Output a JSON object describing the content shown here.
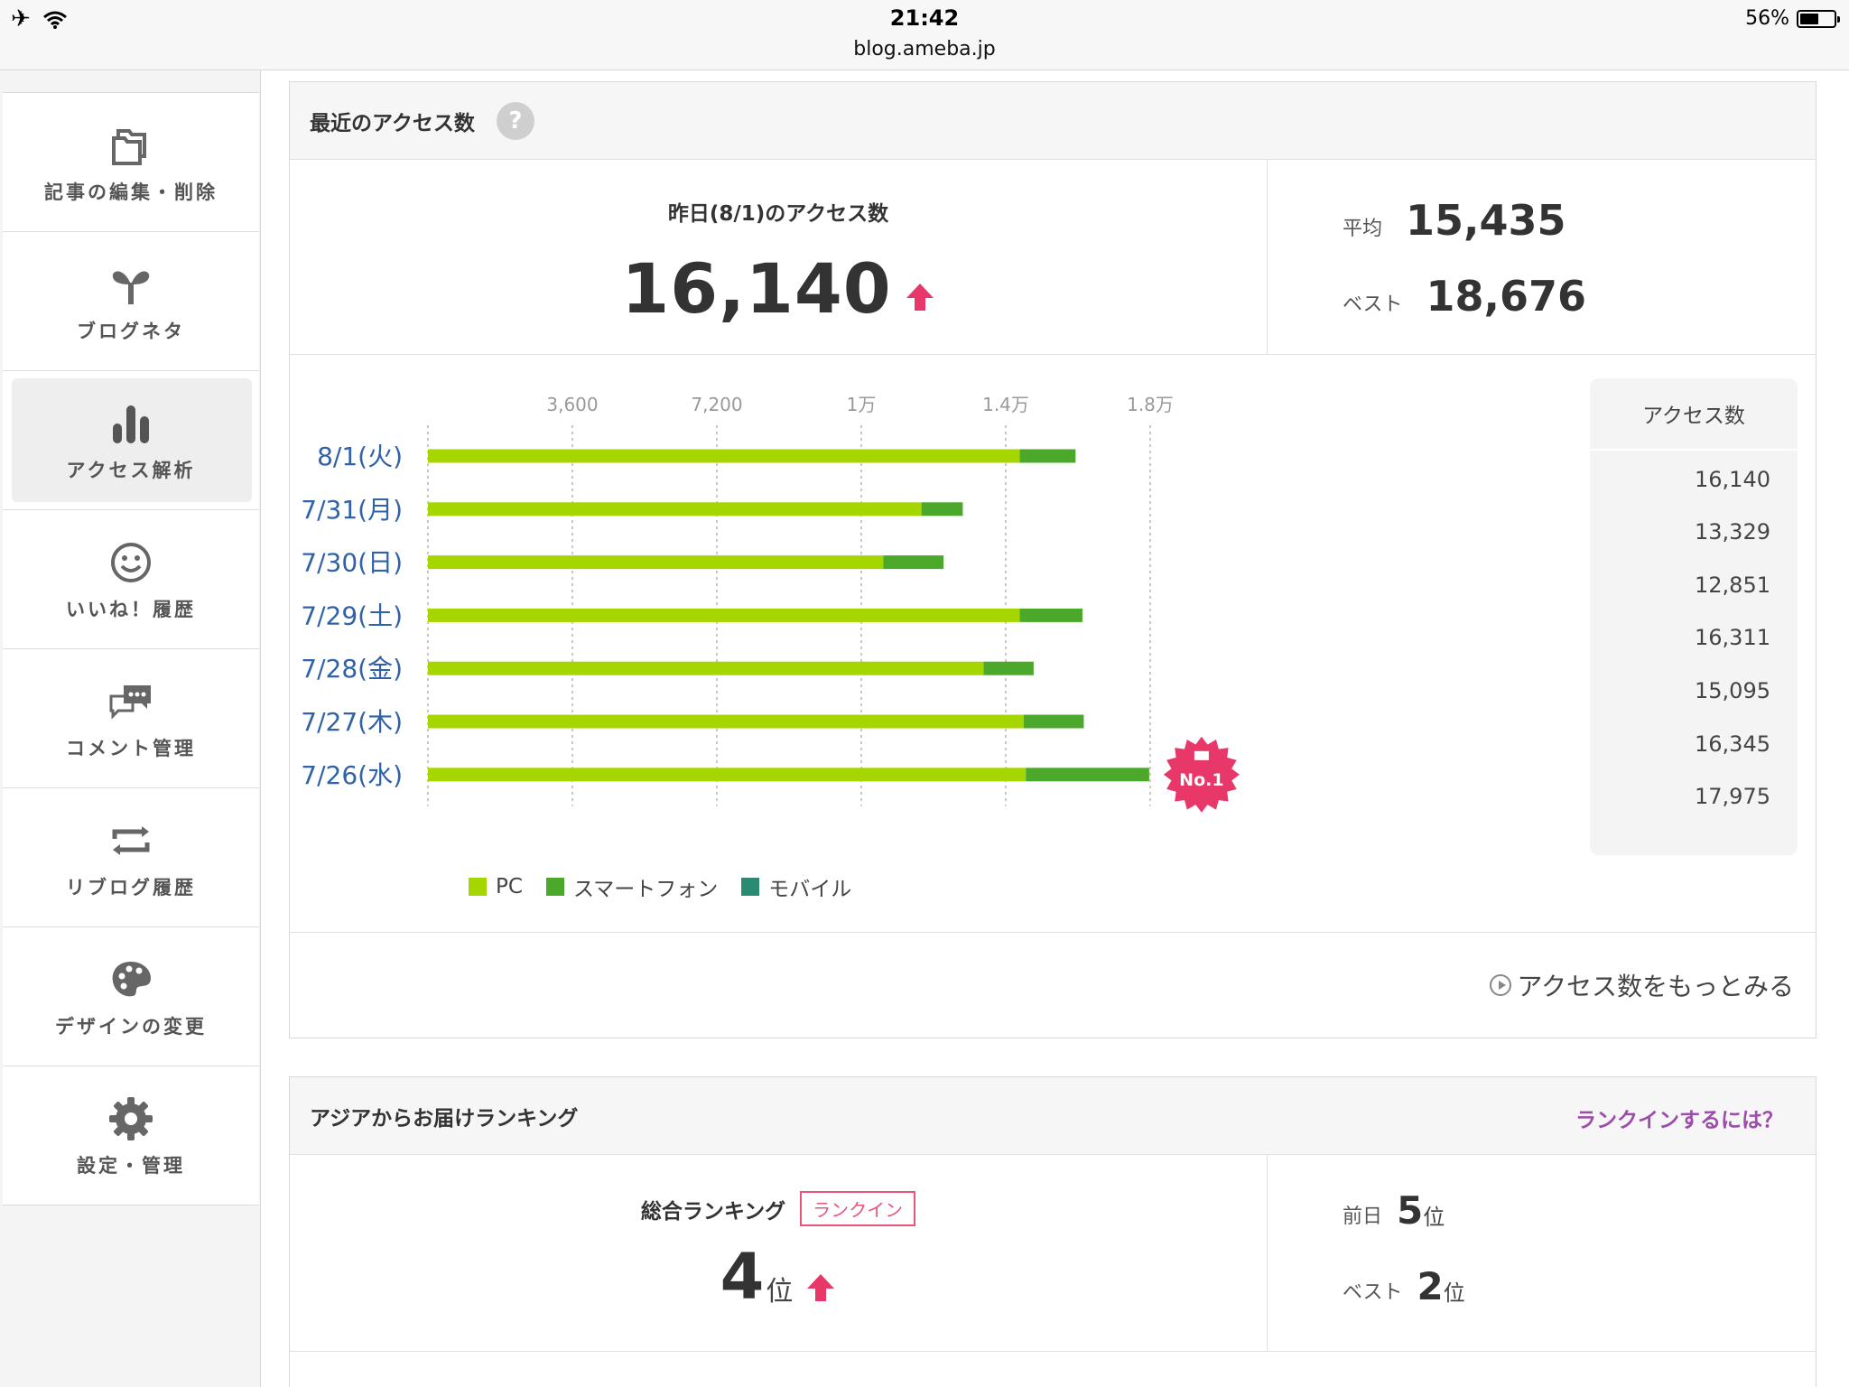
{
  "status_bar": {
    "time": "21:42",
    "url": "blog.ameba.jp",
    "battery": "56%",
    "battery_level": 0.56
  },
  "sidebar": {
    "items": [
      {
        "label": "記事の編集・削除",
        "icon": "folder-icon"
      },
      {
        "label": "ブログネタ",
        "icon": "sprout-icon"
      },
      {
        "label": "アクセス解析",
        "icon": "bar-chart-icon",
        "active": true
      },
      {
        "label": "いいね！履歴",
        "icon": "smile-icon"
      },
      {
        "label": "コメント管理",
        "icon": "speech-bubbles-icon"
      },
      {
        "label": "リブログ履歴",
        "icon": "reblog-icon"
      },
      {
        "label": "デザインの変更",
        "icon": "palette-icon"
      },
      {
        "label": "設定・管理",
        "icon": "gear-icon"
      }
    ]
  },
  "access": {
    "title": "最近のアクセス数",
    "help": "?",
    "yesterday_label": "昨日(8/1)のアクセス数",
    "yesterday_value": "16,140",
    "avg_label": "平均",
    "avg_value": "15,435",
    "best_label": "ベスト",
    "best_value": "18,676",
    "side_header": "アクセス数",
    "more_link": "アクセス数をもっとみる",
    "badge": "No.1"
  },
  "chart_data": {
    "type": "bar",
    "orientation": "horizontal",
    "stacked": true,
    "categories": [
      "8/1(火)",
      "7/31(月)",
      "7/30(日)",
      "7/29(土)",
      "7/28(金)",
      "7/27(木)",
      "7/26(水)"
    ],
    "series": [
      {
        "name": "PC",
        "color": "#a5d600",
        "values": [
          14750,
          12300,
          11350,
          14750,
          13850,
          14850,
          14900
        ]
      },
      {
        "name": "スマートフォン",
        "color": "#4ca82a",
        "values": [
          1390,
          1029,
          1501,
          1561,
          1245,
          1495,
          3075
        ]
      },
      {
        "name": "モバイル",
        "color": "#2a8a72",
        "values": [
          0,
          0,
          0,
          0,
          0,
          0,
          0
        ]
      }
    ],
    "totals": [
      "16,140",
      "13,329",
      "12,851",
      "16,311",
      "15,095",
      "16,345",
      "17,975"
    ],
    "x_ticks": [
      "3,600",
      "7,200",
      "1万",
      "1.4万",
      "1.8万"
    ],
    "x_tick_values": [
      3600,
      7200,
      10800,
      14400,
      18000
    ],
    "xlim": [
      0,
      18000
    ],
    "grid": true,
    "legend_position": "bottom-left"
  },
  "ranking": {
    "title": "アジアからお届けランキング",
    "link": "ランクインするには？",
    "overall_label": "総合ランキング",
    "rankin_badge": "ランクイン",
    "current": "4",
    "unit": "位",
    "prev_label": "前日",
    "prev_value": "5",
    "best_label": "ベスト",
    "best_value": "2"
  },
  "colors": {
    "accent_pink": "#e8386a",
    "link_purple": "#9b4ea8",
    "date_blue": "#2f62a8"
  }
}
